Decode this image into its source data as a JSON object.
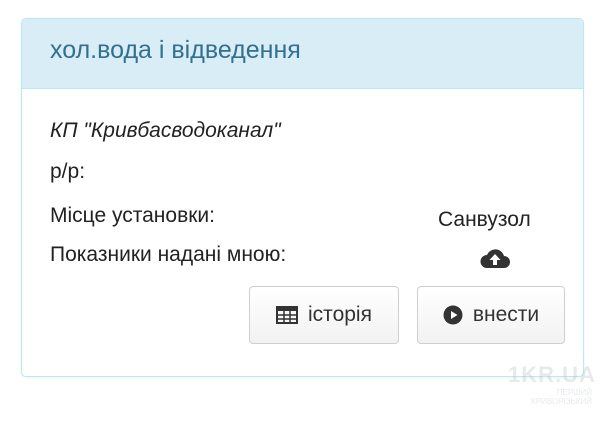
{
  "panel": {
    "title": "хол.вода і відведення",
    "provider": "КП \"Кривбасводоканал\"",
    "account_label": "р/р:",
    "place_label": "Місце установки:",
    "place_value": "Санвузол",
    "readings_label": "Показники надані мною:",
    "icons": {
      "readings": "cloud-upload-icon",
      "history": "table-icon",
      "enter": "play-circle-icon"
    },
    "buttons": {
      "history_label": "історія",
      "enter_label": "внести"
    },
    "colors": {
      "heading_bg": "#d9edf7",
      "heading_text": "#31708f",
      "border": "#bce8f1"
    }
  },
  "watermark": {
    "line1": "1KR.UA",
    "line2": "ПЕРШИЙ",
    "line3": "КРИВОРІЗЬКИЙ"
  }
}
